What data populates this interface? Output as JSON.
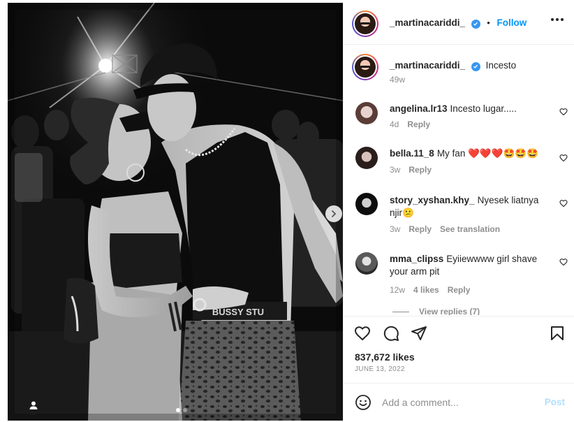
{
  "post": {
    "author": "_martinacariddi_",
    "verified": true,
    "follow_label": "Follow",
    "separator": "•",
    "caption": "Incesto",
    "caption_time": "49w",
    "likes": "837,672 likes",
    "date": "JUNE 13, 2022",
    "carousel": {
      "current": 1,
      "total": 2
    }
  },
  "comments": [
    {
      "user": "angelina.lr13",
      "text": "Incesto lugar.....",
      "time": "4d",
      "reply": "Reply"
    },
    {
      "user": "bella.11_8",
      "text": "My fan ❤️❤️❤️🤩🤩🤩",
      "time": "3w",
      "reply": "Reply"
    },
    {
      "user": "story_xyshan.khy_",
      "text": "Nyesek liatnya njir😕",
      "time": "3w",
      "reply": "Reply",
      "translation": "See translation"
    },
    {
      "user": "mma_clipss",
      "text": "Eyiiewwww girl shave your arm pit",
      "time": "12w",
      "likes": "4 likes",
      "reply": "Reply"
    }
  ],
  "view_replies": "View replies (7)",
  "add_comment": {
    "placeholder": "Add a comment...",
    "post_label": "Post"
  },
  "icons": {
    "like": "heart-icon",
    "comment": "comment-icon",
    "share": "share-icon",
    "save": "bookmark-icon",
    "emoji": "emoji-icon",
    "more": "more-options-icon",
    "next": "chevron-right-icon",
    "tag": "user-tag-icon"
  },
  "colors": {
    "accent": "#0095f6",
    "verified": "#3897f0",
    "muted": "#8e8e8e",
    "post_disabled": "#b2dffc"
  }
}
